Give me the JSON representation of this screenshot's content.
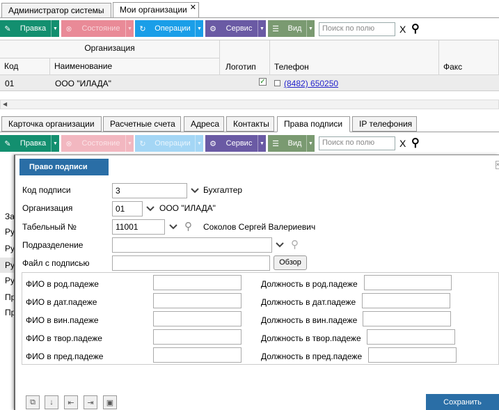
{
  "tabs_top": [
    "Администратор системы",
    "Мои организации"
  ],
  "toolbar": {
    "pravka": "Правка",
    "sostoyanie": "Состояние",
    "operacii": "Операции",
    "servis": "Сервис",
    "vid": "Вид",
    "search_placeholder": "Поиск по полю",
    "clear": "X"
  },
  "grid": {
    "group_header": "Организация",
    "columns": [
      "Код",
      "Наименование",
      "Логотип",
      "Телефон",
      "Факс"
    ],
    "row": {
      "code": "01",
      "name": "ООО \"ИЛАДА\"",
      "phone": "(8482) 650250"
    }
  },
  "tabs_bottom": [
    "Карточка организации",
    "Расчетные счета",
    "Адреса",
    "Контакты",
    "Права подписи",
    "IP телефония"
  ],
  "background_rows": [
    "За",
    "Ру",
    "Ру",
    "Ру",
    "Ру",
    "Пр",
    "Пр"
  ],
  "dialog": {
    "title": "Право подписи",
    "labels": {
      "kod": "Код подписи",
      "org": "Организация",
      "tab": "Табельный №",
      "podr": "Подразделение",
      "file": "Файл с подписью"
    },
    "values": {
      "kod": "3",
      "kod_text": "Бухгалтер",
      "org": "01",
      "org_text": "ООО \"ИЛАДА\"",
      "tab": "11001",
      "tab_text": "Соколов Сергей Валериевич"
    },
    "browse": "Обзор",
    "fio_labels": [
      "ФИО в род.падеже",
      "ФИО в дат.падеже",
      "ФИО в вин.падеже",
      "ФИО в твор.падеже",
      "ФИО в пред.падеже"
    ],
    "pos_labels": [
      "Должность в род.падеже",
      "Должность в дат.падеже",
      "Должность в вин.падеже",
      "Должность в твор.падеже",
      "Должность в пред.падеже"
    ],
    "save": "Сохранить"
  }
}
